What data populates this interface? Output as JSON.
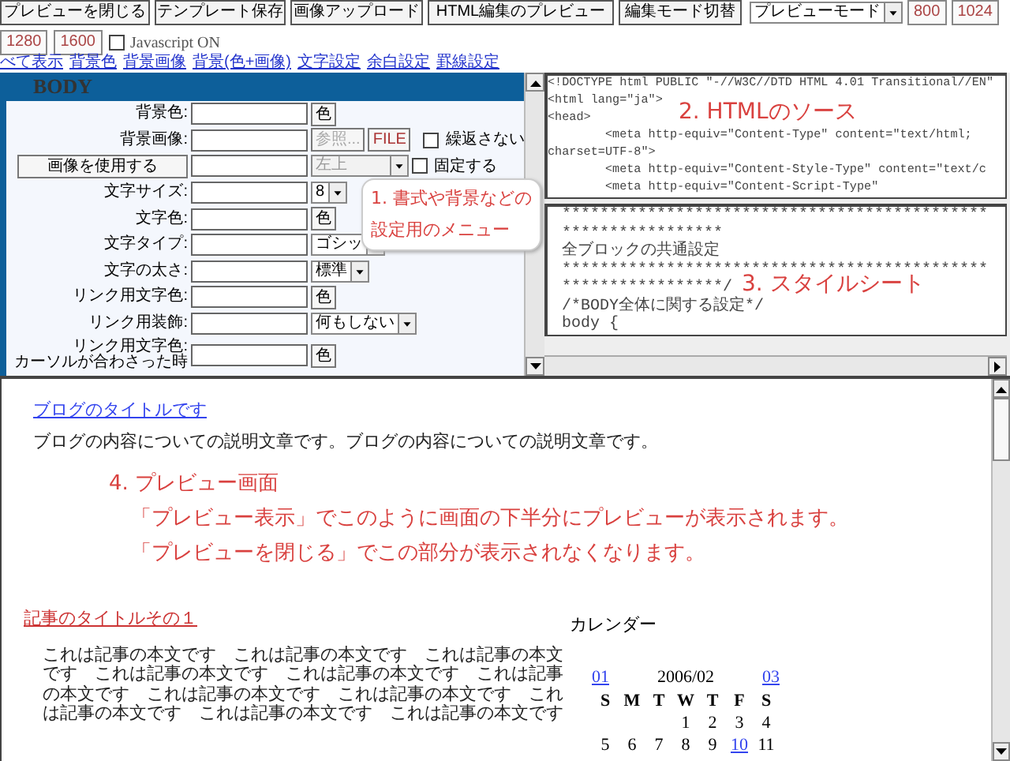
{
  "toolbar": {
    "buttons": [
      "プレビューを閉じる",
      "テンプレート保存",
      "画像アップロード",
      "HTML編集のプレビュー",
      "編集モード切替"
    ],
    "mode_select": "プレビューモード",
    "width_buttons": [
      "800",
      "1024",
      "1280",
      "1600"
    ],
    "javascript": {
      "label": "Javascript ON",
      "checked": false
    }
  },
  "section_links": [
    "べて表示",
    "背景色",
    "背景画像",
    "背景(色+画像)",
    "文字設定",
    "余白設定",
    "罫線設定"
  ],
  "form": {
    "title": "BODY",
    "rows": [
      {
        "kind": "color",
        "label": "背景色:",
        "button": "色"
      },
      {
        "kind": "image",
        "label": "背景画像:",
        "browse": {
          "label": "参照...",
          "disabled": true
        },
        "file_button": "FILE",
        "checkbox": {
          "label": "繰返さない",
          "checked": false
        }
      },
      {
        "kind": "position",
        "use_button": "画像を使用する",
        "select": {
          "value": "左上",
          "disabled": true
        },
        "checkbox": {
          "label": "固定する",
          "checked": false
        }
      },
      {
        "kind": "select",
        "label": "文字サイズ:",
        "select": {
          "value": "8",
          "disabled": false
        }
      },
      {
        "kind": "color",
        "label": "文字色:",
        "button": "色"
      },
      {
        "kind": "select",
        "label": "文字タイプ:",
        "select": {
          "value": "ゴシッ",
          "disabled": false
        }
      },
      {
        "kind": "select",
        "label": "文字の太さ:",
        "select": {
          "value": "標準",
          "disabled": false
        }
      },
      {
        "kind": "color",
        "label": "リンク用文字色:",
        "button": "色"
      },
      {
        "kind": "select",
        "label": "リンク用装飾:",
        "select": {
          "value": "何もしない",
          "disabled": false
        }
      },
      {
        "kind": "color",
        "label": "リンク用文字色:",
        "note": "カーソルが合わさった時",
        "button": "色"
      }
    ],
    "callout": [
      "1. 書式や背景などの",
      "設定用のメニュー"
    ]
  },
  "html_source": {
    "lines": [
      "<!DOCTYPE html PUBLIC \"-//W3C//DTD HTML 4.01 Transitional//EN\"",
      "<html lang=\"ja\">",
      "<head>",
      "        <meta http-equiv=\"Content-Type\" content=\"text/html;",
      "charset=UTF-8\">",
      "        <meta http-equiv=\"Content-Style-Type\" content=\"text/c",
      "        <meta http-equiv=\"Content-Script-Type\""
    ],
    "annotation": "2. HTMLのソース"
  },
  "stylesheet": {
    "lines": [
      "*********************************************",
      "*****************",
      "全ブロックの共通設定",
      "*********************************************",
      "*****************/",
      "/*BODY全体に関する設定*/",
      "body {"
    ],
    "annotation": "3. スタイルシート"
  },
  "preview": {
    "blog_title": "ブログのタイトルです",
    "blog_description": "ブログの内容についての説明文章です。ブログの内容についての説明文章です。",
    "annotation": [
      "4. プレビュー画面",
      "「プレビュー表示」でこのように画面の下半分にプレビューが表示されます。",
      "「プレビューを閉じる」でこの部分が表示されなくなります。"
    ],
    "article_title": "記事のタイトルその１",
    "article_body": "これは記事の本文です　これは記事の本文です　これは記事の本文です　これは記事の本文です　これは記事の本文です　これは記事の本文です　これは記事の本文です　これは記事の本文です　これは記事の本文です　これは記事の本文です　これは記事の本文です",
    "calendar": {
      "heading": "カレンダー",
      "prev": "01",
      "month": "2006/02",
      "next": "03",
      "weekdays": [
        "S",
        "M",
        "T",
        "W",
        "T",
        "F",
        "S"
      ],
      "weeks": [
        [
          {
            "day": "1",
            "link": false
          },
          {
            "day": "2",
            "link": false
          },
          {
            "day": "3",
            "link": false
          },
          {
            "day": "4",
            "link": false
          }
        ],
        [
          {
            "day": "5",
            "link": false
          },
          {
            "day": "6",
            "link": false
          },
          {
            "day": "7",
            "link": false
          },
          {
            "day": "8",
            "link": false
          },
          {
            "day": "9",
            "link": false
          },
          {
            "day": "10",
            "link": true
          },
          {
            "day": "11",
            "link": false
          }
        ]
      ]
    }
  }
}
